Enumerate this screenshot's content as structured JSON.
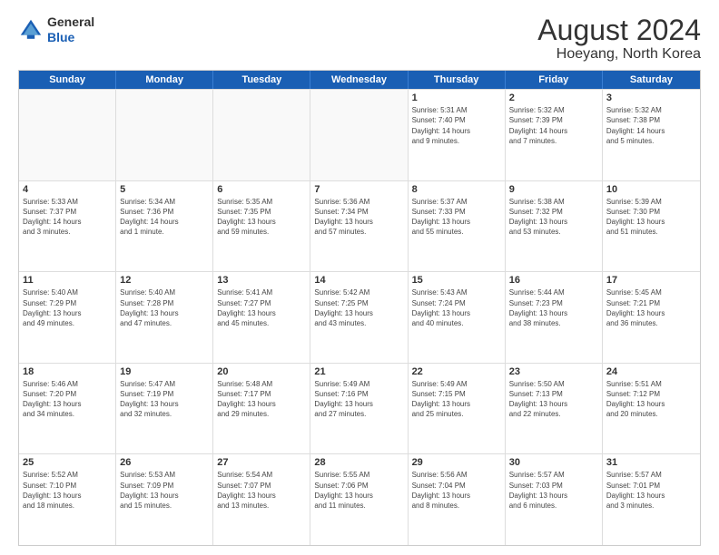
{
  "logo": {
    "general": "General",
    "blue": "Blue"
  },
  "title": "August 2024",
  "subtitle": "Hoeyang, North Korea",
  "days": [
    "Sunday",
    "Monday",
    "Tuesday",
    "Wednesday",
    "Thursday",
    "Friday",
    "Saturday"
  ],
  "rows": [
    [
      {
        "day": "",
        "empty": true
      },
      {
        "day": "",
        "empty": true
      },
      {
        "day": "",
        "empty": true
      },
      {
        "day": "",
        "empty": true
      },
      {
        "day": "1",
        "text": "Sunrise: 5:31 AM\nSunset: 7:40 PM\nDaylight: 14 hours\nand 9 minutes."
      },
      {
        "day": "2",
        "text": "Sunrise: 5:32 AM\nSunset: 7:39 PM\nDaylight: 14 hours\nand 7 minutes."
      },
      {
        "day": "3",
        "text": "Sunrise: 5:32 AM\nSunset: 7:38 PM\nDaylight: 14 hours\nand 5 minutes."
      }
    ],
    [
      {
        "day": "4",
        "text": "Sunrise: 5:33 AM\nSunset: 7:37 PM\nDaylight: 14 hours\nand 3 minutes."
      },
      {
        "day": "5",
        "text": "Sunrise: 5:34 AM\nSunset: 7:36 PM\nDaylight: 14 hours\nand 1 minute."
      },
      {
        "day": "6",
        "text": "Sunrise: 5:35 AM\nSunset: 7:35 PM\nDaylight: 13 hours\nand 59 minutes."
      },
      {
        "day": "7",
        "text": "Sunrise: 5:36 AM\nSunset: 7:34 PM\nDaylight: 13 hours\nand 57 minutes."
      },
      {
        "day": "8",
        "text": "Sunrise: 5:37 AM\nSunset: 7:33 PM\nDaylight: 13 hours\nand 55 minutes."
      },
      {
        "day": "9",
        "text": "Sunrise: 5:38 AM\nSunset: 7:32 PM\nDaylight: 13 hours\nand 53 minutes."
      },
      {
        "day": "10",
        "text": "Sunrise: 5:39 AM\nSunset: 7:30 PM\nDaylight: 13 hours\nand 51 minutes."
      }
    ],
    [
      {
        "day": "11",
        "text": "Sunrise: 5:40 AM\nSunset: 7:29 PM\nDaylight: 13 hours\nand 49 minutes."
      },
      {
        "day": "12",
        "text": "Sunrise: 5:40 AM\nSunset: 7:28 PM\nDaylight: 13 hours\nand 47 minutes."
      },
      {
        "day": "13",
        "text": "Sunrise: 5:41 AM\nSunset: 7:27 PM\nDaylight: 13 hours\nand 45 minutes."
      },
      {
        "day": "14",
        "text": "Sunrise: 5:42 AM\nSunset: 7:25 PM\nDaylight: 13 hours\nand 43 minutes."
      },
      {
        "day": "15",
        "text": "Sunrise: 5:43 AM\nSunset: 7:24 PM\nDaylight: 13 hours\nand 40 minutes."
      },
      {
        "day": "16",
        "text": "Sunrise: 5:44 AM\nSunset: 7:23 PM\nDaylight: 13 hours\nand 38 minutes."
      },
      {
        "day": "17",
        "text": "Sunrise: 5:45 AM\nSunset: 7:21 PM\nDaylight: 13 hours\nand 36 minutes."
      }
    ],
    [
      {
        "day": "18",
        "text": "Sunrise: 5:46 AM\nSunset: 7:20 PM\nDaylight: 13 hours\nand 34 minutes."
      },
      {
        "day": "19",
        "text": "Sunrise: 5:47 AM\nSunset: 7:19 PM\nDaylight: 13 hours\nand 32 minutes."
      },
      {
        "day": "20",
        "text": "Sunrise: 5:48 AM\nSunset: 7:17 PM\nDaylight: 13 hours\nand 29 minutes."
      },
      {
        "day": "21",
        "text": "Sunrise: 5:49 AM\nSunset: 7:16 PM\nDaylight: 13 hours\nand 27 minutes."
      },
      {
        "day": "22",
        "text": "Sunrise: 5:49 AM\nSunset: 7:15 PM\nDaylight: 13 hours\nand 25 minutes."
      },
      {
        "day": "23",
        "text": "Sunrise: 5:50 AM\nSunset: 7:13 PM\nDaylight: 13 hours\nand 22 minutes."
      },
      {
        "day": "24",
        "text": "Sunrise: 5:51 AM\nSunset: 7:12 PM\nDaylight: 13 hours\nand 20 minutes."
      }
    ],
    [
      {
        "day": "25",
        "text": "Sunrise: 5:52 AM\nSunset: 7:10 PM\nDaylight: 13 hours\nand 18 minutes."
      },
      {
        "day": "26",
        "text": "Sunrise: 5:53 AM\nSunset: 7:09 PM\nDaylight: 13 hours\nand 15 minutes."
      },
      {
        "day": "27",
        "text": "Sunrise: 5:54 AM\nSunset: 7:07 PM\nDaylight: 13 hours\nand 13 minutes."
      },
      {
        "day": "28",
        "text": "Sunrise: 5:55 AM\nSunset: 7:06 PM\nDaylight: 13 hours\nand 11 minutes."
      },
      {
        "day": "29",
        "text": "Sunrise: 5:56 AM\nSunset: 7:04 PM\nDaylight: 13 hours\nand 8 minutes."
      },
      {
        "day": "30",
        "text": "Sunrise: 5:57 AM\nSunset: 7:03 PM\nDaylight: 13 hours\nand 6 minutes."
      },
      {
        "day": "31",
        "text": "Sunrise: 5:57 AM\nSunset: 7:01 PM\nDaylight: 13 hours\nand 3 minutes."
      }
    ]
  ]
}
